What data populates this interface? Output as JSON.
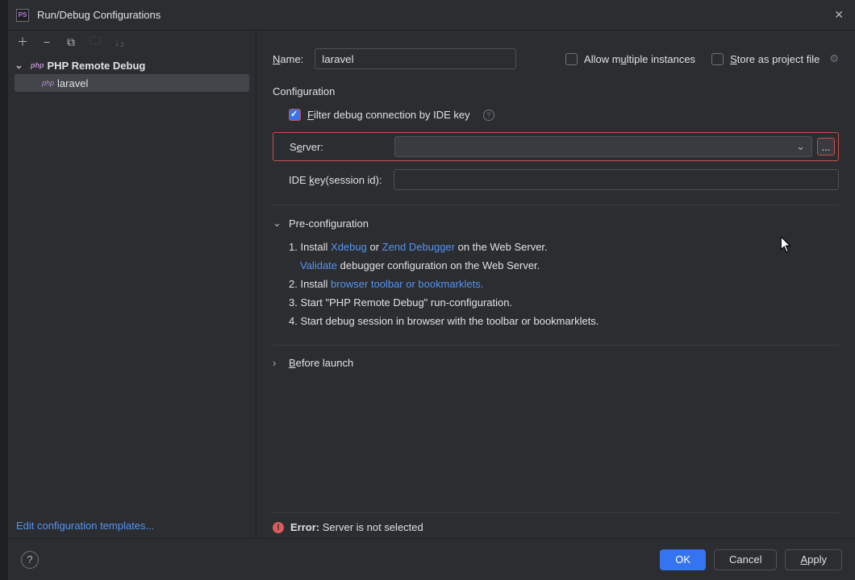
{
  "window": {
    "title": "Run/Debug Configurations"
  },
  "sidebar": {
    "tree_parent": "PHP Remote Debug",
    "tree_child": "laravel",
    "edit_templates": "Edit configuration templates..."
  },
  "form": {
    "name_label": "Name:",
    "name_value": "laravel",
    "allow_multiple": "Allow multiple instances",
    "store_project": "Store as project file",
    "configuration_title": "Configuration",
    "filter_label": "Filter debug connection by IDE key",
    "server_label": "Server:",
    "server_browse": "...",
    "ide_key_label": "IDE key(session id):",
    "preconf_title": "Pre-configuration",
    "step1_a": "1. Install ",
    "step1_link1": "Xdebug",
    "step1_b": " or ",
    "step1_link2": "Zend Debugger",
    "step1_c": " on the Web Server.",
    "step1_validate": "Validate",
    "step1_validate_rest": " debugger configuration on the Web Server.",
    "step2_a": "2. Install ",
    "step2_link": "browser toolbar or bookmarklets.",
    "step3": "3. Start \"PHP Remote Debug\" run-configuration.",
    "step4": "4. Start debug session in browser with the toolbar or bookmarklets.",
    "before_launch": "Before launch",
    "error_label": "Error:",
    "error_msg": " Server is not selected"
  },
  "buttons": {
    "ok": "OK",
    "cancel": "Cancel",
    "apply": "Apply"
  }
}
